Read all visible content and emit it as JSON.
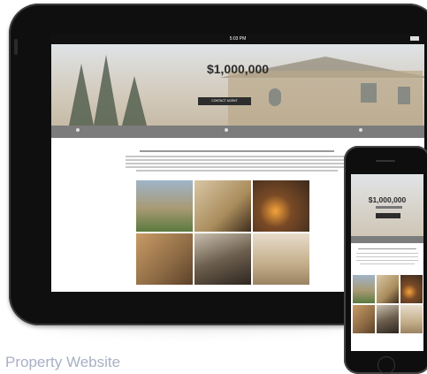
{
  "status_bar": {
    "time": "5:03 PM"
  },
  "listing": {
    "price": "$1,000,000",
    "contact_button": "CONTACT AGENT"
  },
  "phone": {
    "price": "$1,000,000"
  },
  "caption": "Property Website",
  "icons": [
    "battery-icon",
    "nav-icon"
  ]
}
